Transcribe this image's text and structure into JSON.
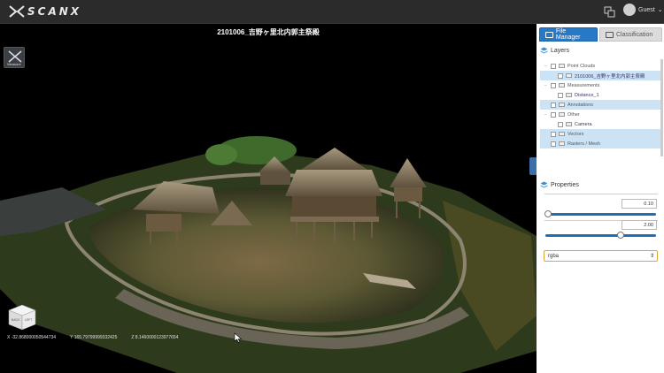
{
  "app": {
    "logo_text": "SCANX",
    "user_label": "Guest",
    "user_caret": "⌄"
  },
  "viewport": {
    "title": "2101006_吉野ヶ里北内郭主祭殿",
    "measure_label": "Measure",
    "cube_faces": [
      "BACK",
      "LEFT"
    ],
    "coords": {
      "x": "X -32.868000050544734",
      "y": "Y 165.79799999332425",
      "z": "Z 8.1460000123977654"
    }
  },
  "panel": {
    "tabs": [
      {
        "label": "File Manager",
        "active": true
      },
      {
        "label": "Classification",
        "active": false
      }
    ],
    "layers_title": "Layers",
    "tree": [
      {
        "label": "Point Clouds",
        "indent": 1,
        "highlight": false,
        "toggle": "−"
      },
      {
        "label": "2101006_吉野ヶ里北内郭主祭殿",
        "indent": 2,
        "highlight": true,
        "toggle": ""
      },
      {
        "label": "Measurements",
        "indent": 1,
        "highlight": false,
        "toggle": "−"
      },
      {
        "label": "Distance_1",
        "indent": 2,
        "highlight": false,
        "toggle": ""
      },
      {
        "label": "Annotations",
        "indent": 1,
        "highlight": true,
        "toggle": ""
      },
      {
        "label": "Other",
        "indent": 1,
        "highlight": false,
        "toggle": "−"
      },
      {
        "label": "Camera",
        "indent": 2,
        "highlight": false,
        "toggle": ""
      },
      {
        "label": "Vectors",
        "indent": 1,
        "highlight": true,
        "toggle": ""
      },
      {
        "label": "Rasters / Mesh",
        "indent": 1,
        "highlight": true,
        "toggle": ""
      }
    ],
    "properties_title": "Properties",
    "property_1": {
      "value": "0.10",
      "slider_fraction": 0.02
    },
    "property_2": {
      "value": "2.00",
      "slider_fraction": 0.68
    },
    "attribute_select": "rgba",
    "select_arrow": "⇕"
  },
  "colors": {
    "accent": "#2878c8",
    "select_border": "#e2a23c",
    "highlight": "#cce3f6"
  }
}
